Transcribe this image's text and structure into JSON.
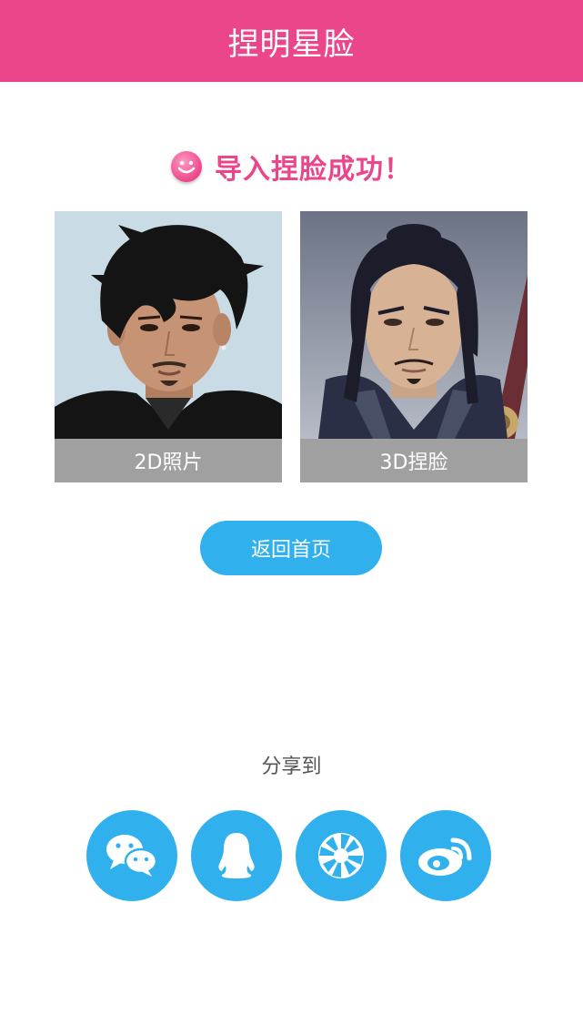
{
  "header": {
    "title": "捏明星脸"
  },
  "status": {
    "message": "导入捏脸成功！"
  },
  "cards": [
    {
      "caption": "2D照片",
      "image": "real-photo-portrait"
    },
    {
      "caption": "3D捏脸",
      "image": "3d-character-portrait"
    }
  ],
  "actions": {
    "home_label": "返回首页"
  },
  "share": {
    "label": "分享到",
    "targets": [
      {
        "icon": "wechat-icon"
      },
      {
        "icon": "qq-icon"
      },
      {
        "icon": "moments-icon"
      },
      {
        "icon": "weibo-icon"
      }
    ]
  },
  "colors": {
    "header": "#ec468a",
    "accent_pink": "#ec468a",
    "button_blue": "#30b1ee",
    "caption_gray": "#a0a0a0"
  }
}
